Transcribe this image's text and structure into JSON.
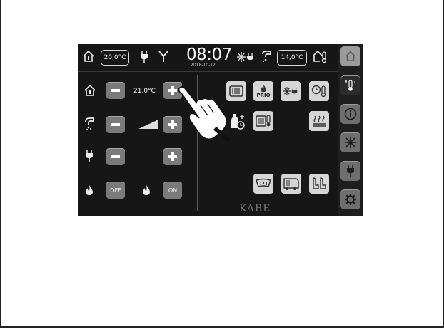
{
  "topbar": {
    "inside_temp": "20,0°C",
    "time": "08:07",
    "date": "2018-10-12",
    "outside_temp": "14,0°C"
  },
  "controls": {
    "set_temp": "21,0°C",
    "off_label": "OFF",
    "on_label": "ON"
  },
  "tiles": {
    "prio_label": "PRIO"
  },
  "brand": "KABE",
  "icons": {
    "sidebar": [
      "home-icon",
      "thermometer-heat-icon",
      "info-icon",
      "snowflake-icon",
      "plug-icon",
      "gear-icon"
    ]
  }
}
